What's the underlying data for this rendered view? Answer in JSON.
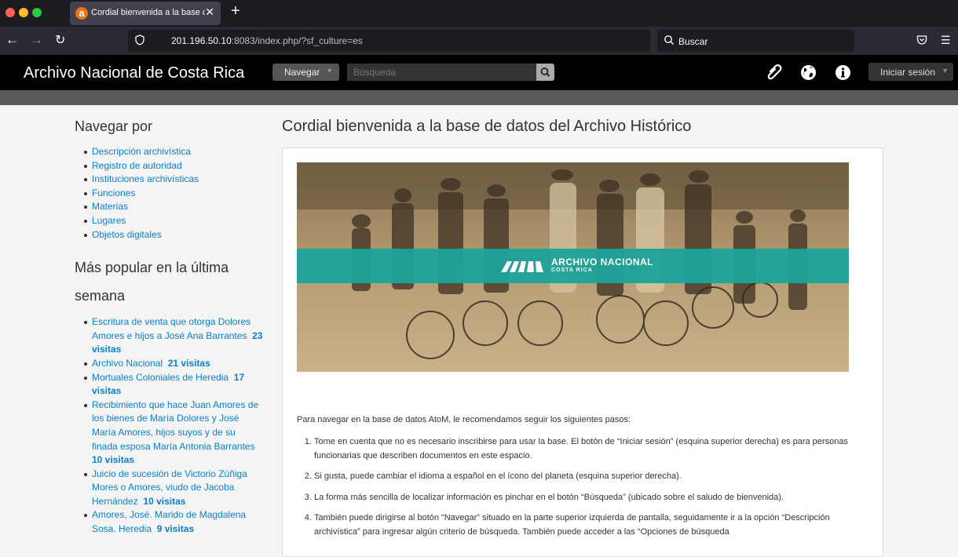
{
  "browser": {
    "tab_title": "Cordial bienvenida a la base de datos del Archivo Histórico",
    "url_host": "201.196.50.10",
    "url_rest": ":8083/index.php/?sf_culture=es",
    "search_placeholder": "Buscar"
  },
  "header": {
    "site_title": "Archivo Nacional de Costa Rica",
    "browse_label": "Navegar",
    "search_placeholder": "Búsqueda",
    "login_label": "Iniciar sesión"
  },
  "sidebar": {
    "browse_heading": "Navegar por",
    "browse_items": [
      "Descripción archivística",
      "Registro de autoridad",
      "Instituciones archivísticas",
      "Funciones",
      "Materias",
      "Lugares",
      "Objetos digitales"
    ],
    "popular_heading_line1": "Más popular en la última",
    "popular_heading_line2": "semana",
    "popular_items": [
      {
        "label": "Escritura de venta que otorga Dolores Amores e hijos a José Ana Barrantes",
        "visits": "23 visitas"
      },
      {
        "label": "Archivo Nacional",
        "visits": "21 visitas"
      },
      {
        "label": "Mortuales Coloniales de Heredia",
        "visits": "17 visitas"
      },
      {
        "label": "Recibimiento que hace Juan Amores de los bienes de María Dolores y José María Amores, hijos suyos y de su finada esposa María Antonia Barrantes",
        "visits": "10 visitas"
      },
      {
        "label": "Juicio de sucesión de Victorio Zúñiga Mores o Amores, viudo de Jacoba Hernández",
        "visits": "10 visitas"
      },
      {
        "label": "Amores, José. Marido de Magdalena Sosa. Heredia",
        "visits": "9 visitas"
      }
    ]
  },
  "main": {
    "title": "Cordial bienvenida a la base de datos del Archivo Histórico",
    "banner_line1": "ARCHIVO NACIONAL",
    "banner_line2": "COSTA RICA",
    "intro": "Para navegar en la base de datos AtoM, le recomendamos seguir los siguientes pasos:",
    "steps": [
      "Tome en cuenta que no es necesario inscribirse para usar la base. El botón de “Iniciar sesión” (esquina superior derecha) es para personas funcionarias que describen documentos en este espacio.",
      "Si gusta, puede cambiar el idioma a español en el ícono del planeta (esquina superior derecha).",
      "La forma más sencilla de localizar información es pinchar en el botón “Búsqueda” (ubicado sobre el saludo de bienvenida).",
      "También puede dirigirse al botón “Navegar” situado en la parte superior izquierda de pantalla, seguidamente ir a la opción “Descripción archivística” para ingresar algún criterio de búsqueda. También puede acceder a las “Opciones de búsqueda"
    ]
  },
  "colors": {
    "link": "#0a80c6",
    "banner": "#1ea39b",
    "header_bg": "#000000"
  }
}
